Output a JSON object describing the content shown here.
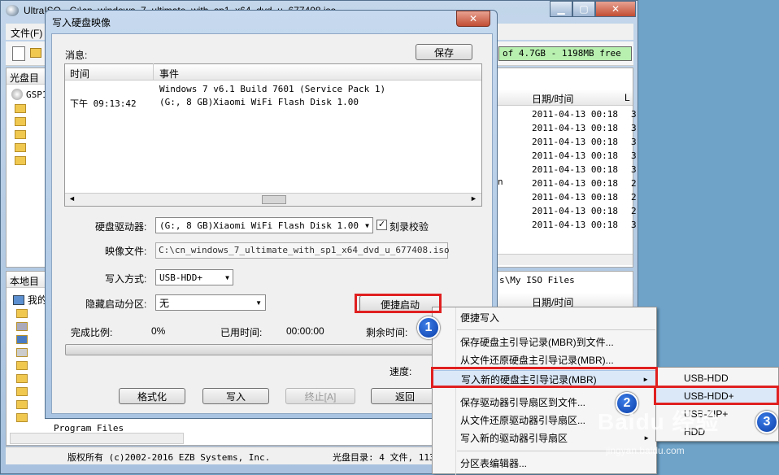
{
  "main_window": {
    "title": "UltraISO - C:\\cn_windows_7_ultimate_with_sp1_x64_dvd_u_677408.iso",
    "menu_first": "文件(F)",
    "toolbar_capacity": "of 4.7GB - 1198MB free",
    "top_pane_label": "光盘目",
    "tree_root": "GSP1",
    "iso_col_date": "日期/时间",
    "iso_col_l": "L",
    "iso_rows": [
      {
        "date": "2011-04-13 00:18",
        "l": "3"
      },
      {
        "date": "2011-04-13 00:18",
        "l": "3"
      },
      {
        "date": "2011-04-13 00:18",
        "l": "3"
      },
      {
        "date": "2011-04-13 00:18",
        "l": "3"
      },
      {
        "date": "2011-04-13 00:18",
        "l": "3"
      },
      {
        "date": "2011-04-13 00:18",
        "l": "2"
      },
      {
        "date": "2011-04-13 00:18",
        "l": "2"
      },
      {
        "date": "2011-04-13 00:18",
        "l": "2"
      },
      {
        "date": "2011-04-13 00:18",
        "l": "3"
      }
    ],
    "iso_row_fragment": "n",
    "bottom_pane_label": "本地目",
    "local_tree_root": "我的",
    "local_tree_last": "Program Files",
    "local_path": "s\\My ISO Files",
    "local_col_date": "日期/时间",
    "status_copyright": "版权所有 (c)2002-2016 EZB Systems, Inc.",
    "status_disc": "光盘目录: 4 文件, 113"
  },
  "dialog": {
    "title": "写入硬盘映像",
    "close_glyph": "✕",
    "messages_label": "消息:",
    "save_button": "保存",
    "log_col_time": "时间",
    "log_col_event": "事件",
    "log_event_line1": "Windows 7 v6.1 Build 7601 (Service Pack 1)",
    "log_time": "下午 09:13:42",
    "log_event_line2": "(G:, 8 GB)Xiaomi  WiFi Flash Disk 1.00",
    "drive_label": "硬盘驱动器:",
    "drive_value": "(G:, 8 GB)Xiaomi  WiFi Flash Disk 1.00",
    "verify_label": "刻录校验",
    "verify_checked": true,
    "image_label": "映像文件:",
    "image_value": "C:\\cn_windows_7_ultimate_with_sp1_x64_dvd_u_677408.iso",
    "write_mode_label": "写入方式:",
    "write_mode_value": "USB-HDD+",
    "hide_part_label": "隐藏启动分区:",
    "hide_part_value": "无",
    "quick_boot_button": "便捷启动",
    "progress_label": "完成比例:",
    "progress_value": "0%",
    "progress_fraction": 0,
    "elapsed_label": "已用时间:",
    "elapsed_value": "00:00:00",
    "remaining_label": "剩余时间:",
    "speed_label": "速度:",
    "format_button": "格式化",
    "write_button": "写入",
    "stop_button": "终止[A]",
    "return_button": "返回"
  },
  "context_menu": {
    "items": [
      "便捷写入",
      "保存硬盘主引导记录(MBR)到文件...",
      "从文件还原硬盘主引导记录(MBR)...",
      "写入新的硬盘主引导记录(MBR)",
      "保存驱动器引导扇区到文件...",
      "从文件还原驱动器引导扇区...",
      "写入新的驱动器引导扇区",
      "分区表编辑器..."
    ]
  },
  "submenu": {
    "items": [
      "USB-HDD",
      "USB-HDD+",
      "USB-ZIP+",
      "HDD"
    ]
  },
  "badges": [
    "1",
    "2",
    "3"
  ],
  "watermark": {
    "text": "Baidu 经验",
    "url": "jingyan.baidu.com"
  },
  "colors": {
    "highlight_box": "#e02020",
    "badge": "#1a55c8"
  }
}
